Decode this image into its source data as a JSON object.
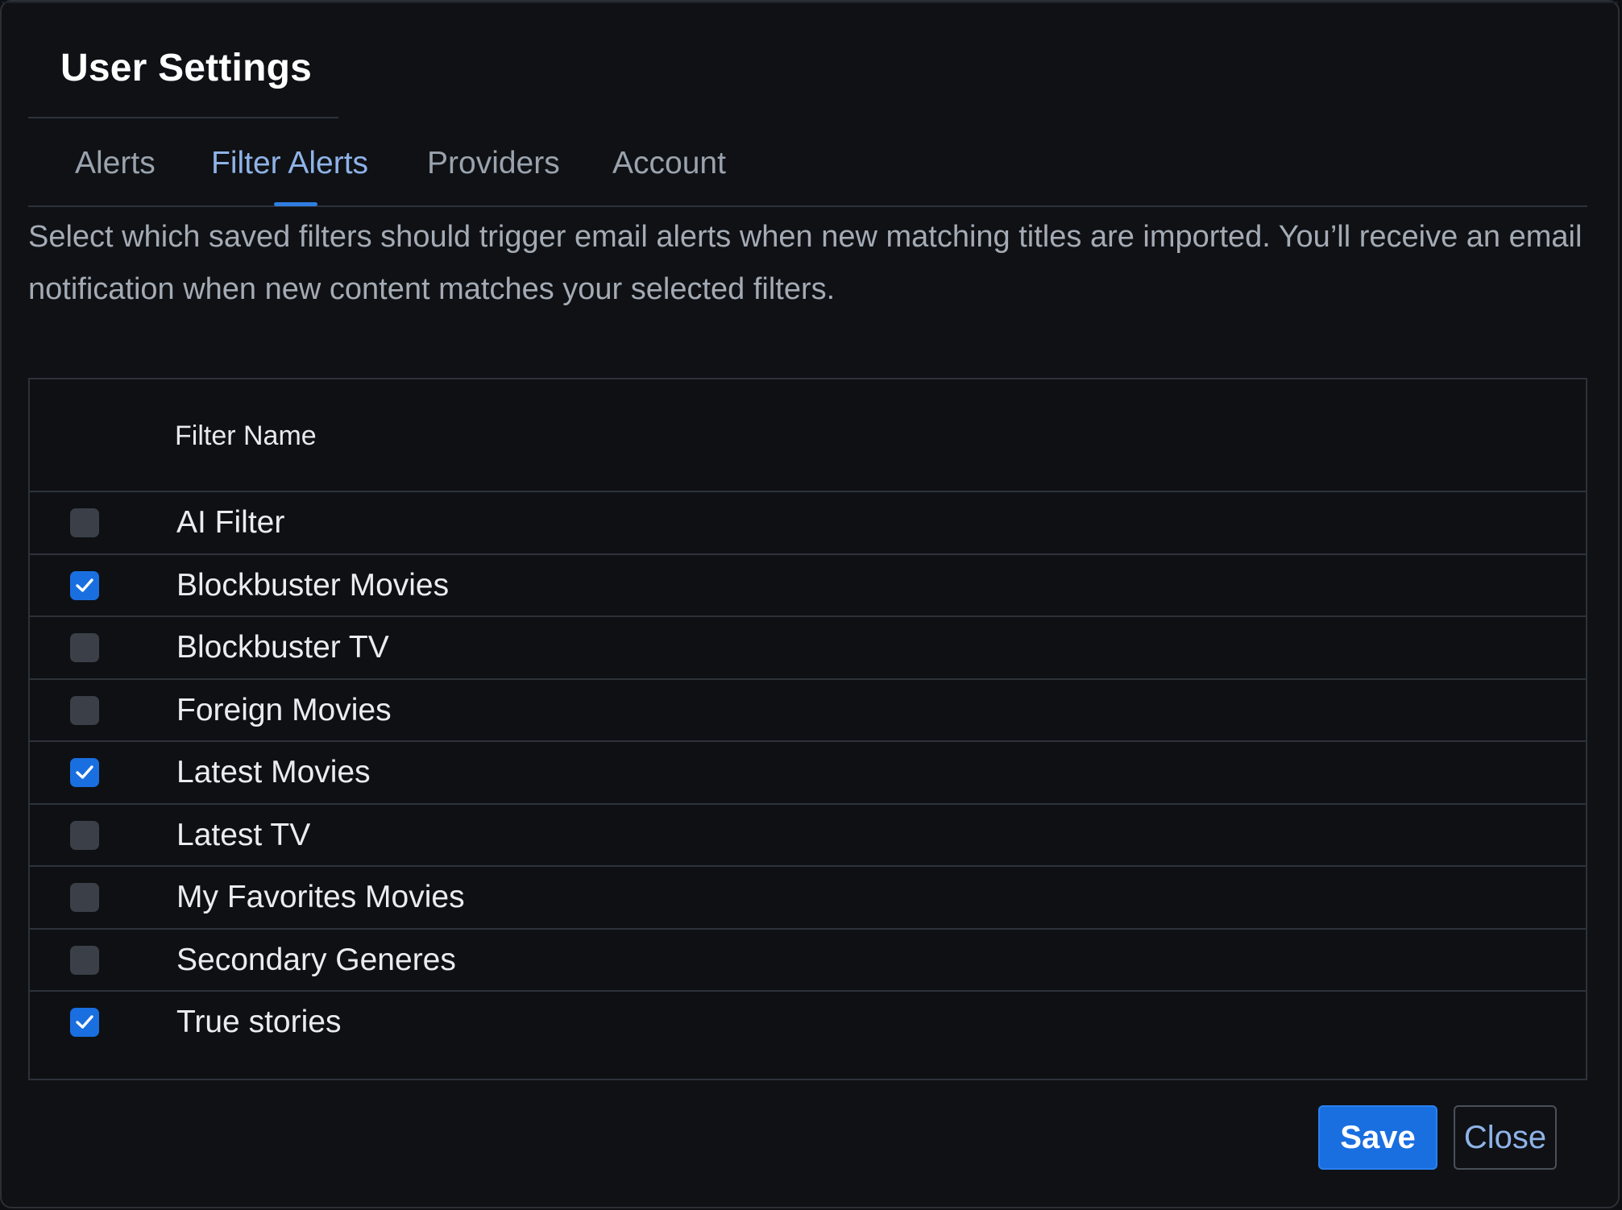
{
  "dialog": {
    "title": "User Settings"
  },
  "tabs": [
    {
      "label": "Alerts",
      "active": false
    },
    {
      "label": "Filter Alerts",
      "active": true
    },
    {
      "label": "Providers",
      "active": false
    },
    {
      "label": "Account",
      "active": false
    }
  ],
  "description": "Select which saved filters should trigger email alerts when new matching titles are imported. You’ll receive an email notification when new content matches your selected filters.",
  "table": {
    "column_header": "Filter Name",
    "rows": [
      {
        "name": "AI Filter",
        "checked": false
      },
      {
        "name": "Blockbuster Movies",
        "checked": true
      },
      {
        "name": "Blockbuster TV",
        "checked": false
      },
      {
        "name": "Foreign Movies",
        "checked": false
      },
      {
        "name": "Latest Movies",
        "checked": true
      },
      {
        "name": "Latest TV",
        "checked": false
      },
      {
        "name": "My Favorites Movies",
        "checked": false
      },
      {
        "name": "Secondary Generes",
        "checked": false
      },
      {
        "name": "True stories",
        "checked": true
      }
    ]
  },
  "buttons": {
    "save_label": "Save",
    "close_label": "Close"
  },
  "colors": {
    "accent": "#1a6fe0",
    "active_tab_text": "#8fb3e8",
    "background": "#0f1115"
  },
  "icons": {
    "check": "check-icon"
  }
}
